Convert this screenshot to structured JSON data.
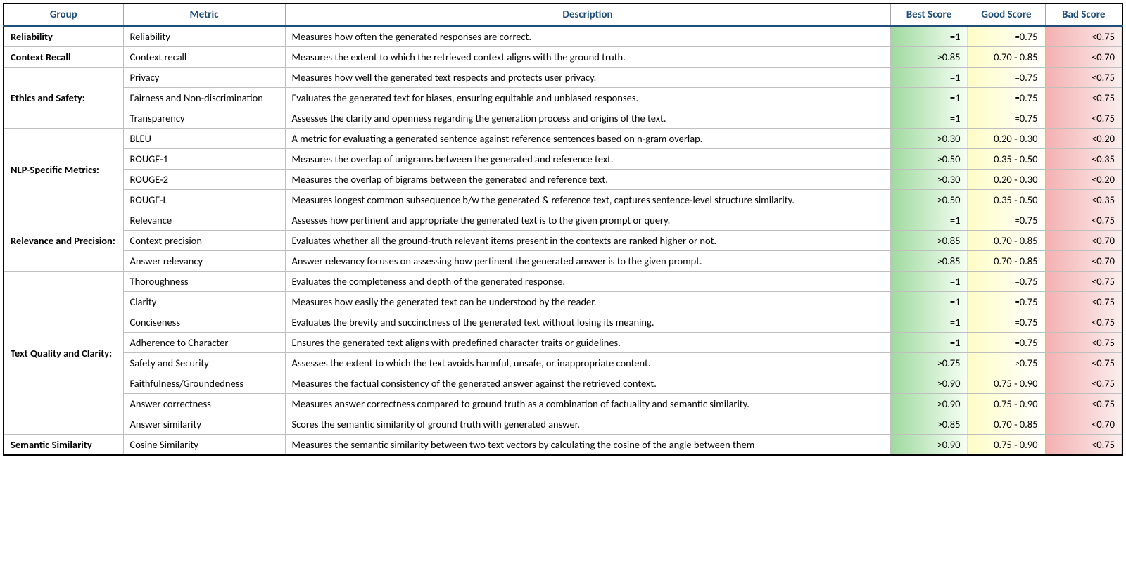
{
  "headers": {
    "group": "Group",
    "metric": "Metric",
    "description": "Description",
    "best": "Best Score",
    "good": "Good Score",
    "bad": "Bad Score"
  },
  "groups": [
    {
      "name": "Reliability",
      "rows": [
        {
          "metric": "Reliability",
          "desc": "Measures how often the generated responses are correct.",
          "best": "=1",
          "good": "=0.75",
          "bad": "<0.75"
        }
      ]
    },
    {
      "name": "Context Recall",
      "rows": [
        {
          "metric": "Context recall",
          "desc": "Measures the extent to which the retrieved context aligns with the ground truth.",
          "best": ">0.85",
          "good": "0.70 - 0.85",
          "bad": "<0.70"
        }
      ]
    },
    {
      "name": "Ethics and Safety:",
      "rows": [
        {
          "metric": "Privacy",
          "desc": "Measures how well the generated text respects and protects user privacy.",
          "best": "=1",
          "good": "=0.75",
          "bad": "<0.75"
        },
        {
          "metric": "Fairness and Non-discrimination",
          "desc": "Evaluates the generated text for biases, ensuring equitable and unbiased responses.",
          "best": "=1",
          "good": "=0.75",
          "bad": "<0.75"
        },
        {
          "metric": "Transparency",
          "desc": "Assesses the clarity and openness regarding the generation process and origins of the text.",
          "best": "=1",
          "good": "=0.75",
          "bad": "<0.75"
        }
      ]
    },
    {
      "name": "NLP-Specific Metrics:",
      "rows": [
        {
          "metric": "BLEU",
          "desc": "A metric for evaluating a generated sentence against reference sentences based on n-gram overlap.",
          "best": ">0.30",
          "good": "0.20 - 0.30",
          "bad": "<0.20"
        },
        {
          "metric": "ROUGE-1",
          "desc": "Measures the overlap of unigrams between the generated and reference text.",
          "best": ">0.50",
          "good": "0.35 - 0.50",
          "bad": "<0.35"
        },
        {
          "metric": "ROUGE-2",
          "desc": "Measures the overlap of bigrams between the generated and reference text.",
          "best": ">0.30",
          "good": "0.20 - 0.30",
          "bad": "<0.20"
        },
        {
          "metric": "ROUGE-L",
          "desc": "Measures longest common subsequence b/w the generated & reference text, captures sentence-level structure similarity.",
          "best": ">0.50",
          "good": "0.35 - 0.50",
          "bad": "<0.35"
        }
      ]
    },
    {
      "name": "Relevance and Precision:",
      "rows": [
        {
          "metric": "Relevance",
          "desc": "Assesses how pertinent and appropriate the generated text is to the given prompt or query.",
          "best": "=1",
          "good": "=0.75",
          "bad": "<0.75"
        },
        {
          "metric": "Context precision",
          "desc": "Evaluates whether all the ground-truth relevant items present in the contexts are ranked higher or not.",
          "best": ">0.85",
          "good": "0.70 - 0.85",
          "bad": "<0.70"
        },
        {
          "metric": "Answer relevancy",
          "desc": "Answer relevancy focuses on assessing how pertinent the generated answer is to the given prompt.",
          "best": ">0.85",
          "good": "0.70 - 0.85",
          "bad": "<0.70"
        }
      ]
    },
    {
      "name": "Text Quality and Clarity:",
      "rows": [
        {
          "metric": "Thoroughness",
          "desc": "Evaluates the completeness and depth of the generated response.",
          "best": "=1",
          "good": "=0.75",
          "bad": "<0.75"
        },
        {
          "metric": "Clarity",
          "desc": "Measures how easily the generated text can be understood by the reader.",
          "best": "=1",
          "good": "=0.75",
          "bad": "<0.75"
        },
        {
          "metric": "Conciseness",
          "desc": "Evaluates the brevity and succinctness of the generated text without losing its meaning.",
          "best": "=1",
          "good": "=0.75",
          "bad": "<0.75"
        },
        {
          "metric": "Adherence to Character",
          "desc": "Ensures the generated text aligns with predefined character traits or guidelines.",
          "best": "=1",
          "good": "=0.75",
          "bad": "<0.75"
        },
        {
          "metric": "Safety and Security",
          "desc": "Assesses the extent to which the text avoids harmful, unsafe, or inappropriate content.",
          "best": ">0.75",
          "good": ">0.75",
          "bad": "<0.75"
        },
        {
          "metric": "Faithfulness/Groundedness",
          "desc": "Measures the factual consistency of the generated answer against the retrieved context.",
          "best": ">0.90",
          "good": "0.75 - 0.90",
          "bad": "<0.75"
        },
        {
          "metric": "Answer correctness",
          "desc": "Measures answer correctness compared to ground truth as a combination of factuality and semantic similarity.",
          "best": ">0.90",
          "good": "0.75 - 0.90",
          "bad": "<0.75"
        },
        {
          "metric": "Answer similarity",
          "desc": "Scores the semantic similarity of ground truth with generated answer.",
          "best": ">0.85",
          "good": "0.70 - 0.85",
          "bad": "<0.70"
        }
      ]
    },
    {
      "name": "Semantic Similarity",
      "rows": [
        {
          "metric": "Cosine Similarity",
          "desc": "Measures the semantic similarity between two text vectors by calculating the cosine of the angle between them",
          "best": ">0.90",
          "good": "0.75 - 0.90",
          "bad": "<0.75"
        }
      ]
    }
  ]
}
